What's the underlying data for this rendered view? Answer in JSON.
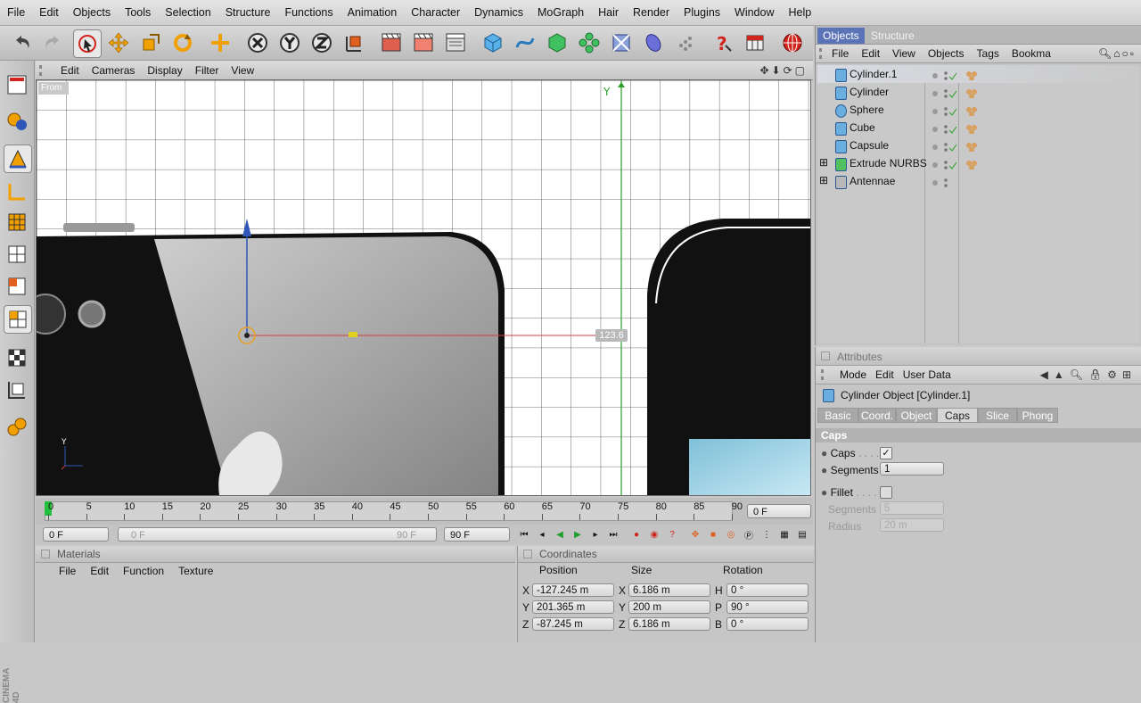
{
  "menubar": [
    "File",
    "Edit",
    "Objects",
    "Tools",
    "Selection",
    "Structure",
    "Functions",
    "Animation",
    "Character",
    "Dynamics",
    "MoGraph",
    "Hair",
    "Render",
    "Plugins",
    "Window",
    "Help"
  ],
  "viewport": {
    "menu": [
      "Edit",
      "Cameras",
      "Display",
      "Filter",
      "View"
    ],
    "view_label": "From",
    "measure_label": "123.6",
    "axis_y": "Y",
    "gizmo_y": "Y"
  },
  "timeline": {
    "ticks": [
      "0",
      "5",
      "10",
      "15",
      "20",
      "25",
      "30",
      "35",
      "40",
      "45",
      "50",
      "55",
      "60",
      "65",
      "70",
      "75",
      "80",
      "85",
      "90"
    ],
    "current_frame": "0 F",
    "start_frame": "0 F",
    "range_start": "0 F",
    "range_end": "90 F",
    "end_frame": "90 F"
  },
  "materials": {
    "title": "Materials",
    "menu": [
      "File",
      "Edit",
      "Function",
      "Texture"
    ]
  },
  "coordinates": {
    "title": "Coordinates",
    "headers": [
      "Position",
      "Size",
      "Rotation"
    ],
    "rows": [
      {
        "axis": "X",
        "pos": "-127.245 m",
        "size_axis": "X",
        "size": "6.186 m",
        "rot_axis": "H",
        "rot": "0 °"
      },
      {
        "axis": "Y",
        "pos": "201.365 m",
        "size_axis": "Y",
        "size": "200 m",
        "rot_axis": "P",
        "rot": "90 °"
      },
      {
        "axis": "Z",
        "pos": "-87.245 m",
        "size_axis": "Z",
        "size": "6.186 m",
        "rot_axis": "B",
        "rot": "0 °"
      }
    ]
  },
  "objects_panel": {
    "tabs": [
      "Objects",
      "Structure"
    ],
    "menu": [
      "File",
      "Edit",
      "View",
      "Objects",
      "Tags",
      "Bookma"
    ],
    "items": [
      {
        "name": "Cylinder.1",
        "selected": true,
        "expand": false
      },
      {
        "name": "Cylinder",
        "selected": false,
        "expand": false
      },
      {
        "name": "Sphere",
        "selected": false,
        "expand": false
      },
      {
        "name": "Cube",
        "selected": false,
        "expand": false
      },
      {
        "name": "Capsule",
        "selected": false,
        "expand": false
      },
      {
        "name": "Extrude NURBS",
        "selected": false,
        "expand": true
      },
      {
        "name": "Antennae",
        "selected": false,
        "expand": true
      }
    ]
  },
  "attributes": {
    "title": "Attributes",
    "menu": [
      "Mode",
      "Edit",
      "User Data"
    ],
    "object_title": "Cylinder Object [Cylinder.1]",
    "tabs": [
      "Basic",
      "Coord.",
      "Object",
      "Caps",
      "Slice",
      "Phong"
    ],
    "active_tab": "Caps",
    "section": "Caps",
    "fields": {
      "caps_label": "Caps",
      "segments_label": "Segments",
      "segments_value": "1",
      "fillet_label": "Fillet",
      "fillet_segments_label": "Segments",
      "fillet_segments_value": "5",
      "radius_label": "Radius",
      "radius_value": "20 m"
    }
  },
  "colors": {
    "accent_blue": "#2f56b8",
    "selection_blue": "#4a6fd0",
    "play_green": "#1e9e2a",
    "record_red": "#d0241c"
  }
}
